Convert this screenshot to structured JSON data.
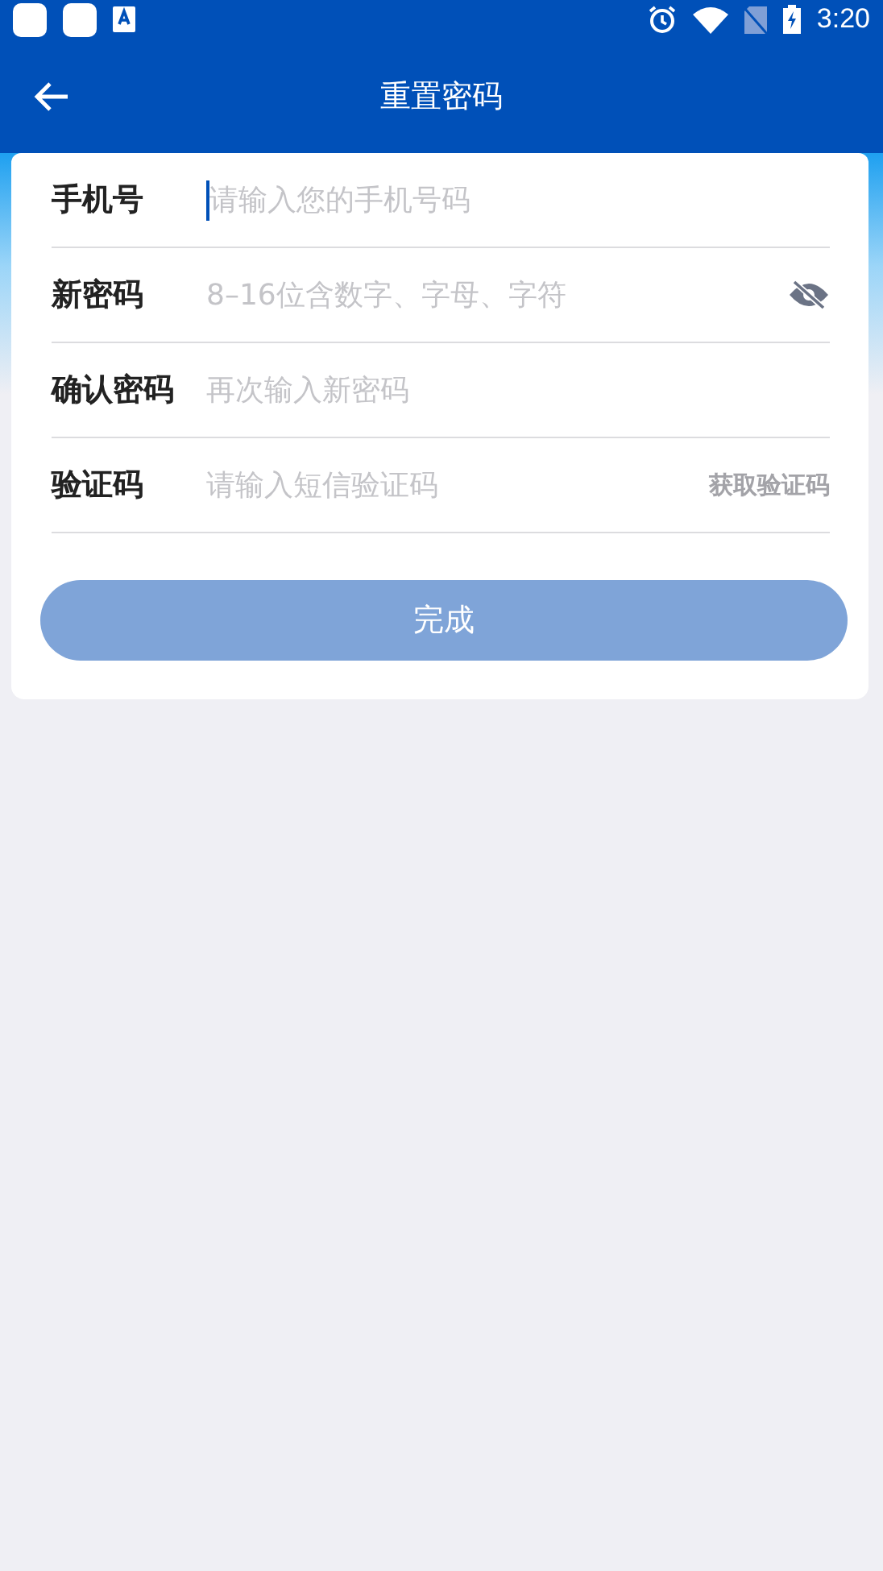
{
  "status_bar": {
    "time": "3:20"
  },
  "app_bar": {
    "title": "重置密码"
  },
  "fields": [
    {
      "kind": "plain",
      "label": "手机号",
      "placeholder": "请输入您的手机号码",
      "focused": true
    },
    {
      "kind": "password",
      "label": "新密码",
      "placeholder": "8–16位含数字、字母、字符",
      "focused": false
    },
    {
      "kind": "plain",
      "label": "确认密码",
      "placeholder": "再次输入新密码",
      "focused": false
    },
    {
      "kind": "code",
      "label": "验证码",
      "placeholder": "请输入短信验证码",
      "focused": false,
      "action": "获取验证码"
    }
  ],
  "submit": {
    "label": "完成",
    "disabled": true
  }
}
